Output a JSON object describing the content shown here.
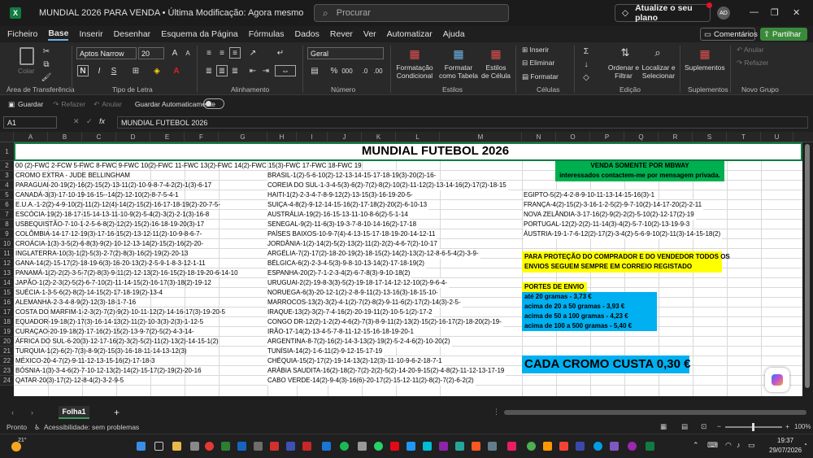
{
  "window": {
    "title": "MUNDIAL 2026 PARA VENDA • Última Modificação: Agora mesmo",
    "search_placeholder": "Procurar",
    "upgrade_label": "Atualize o seu plano",
    "avatar_initials": "AD"
  },
  "menu": [
    "Ficheiro",
    "Base",
    "Inserir",
    "Desenhar",
    "Esquema da Página",
    "Fórmulas",
    "Dados",
    "Rever",
    "Ver",
    "Automatizar",
    "Ajuda"
  ],
  "menu_active": "Base",
  "top_right": {
    "comments": "Comentários",
    "share": "Partilhar"
  },
  "ribbon": {
    "clipboard": {
      "paste": "Colar",
      "label": "Área de Transferência"
    },
    "font": {
      "name": "Aptos Narrow",
      "size": "20",
      "label": "Tipo de Letra",
      "bold": "N",
      "italic": "I",
      "underline": "S"
    },
    "alignment": {
      "label": "Alinhamento"
    },
    "number": {
      "format": "Geral",
      "label": "Número",
      "percent": "%",
      "thousands": "000"
    },
    "styles": {
      "conditional": "Formatação Condicional",
      "table": "Formatar como Tabela",
      "cell": "Estilos de Célula",
      "label": "Estilos"
    },
    "cells": {
      "insert": "Inserir",
      "delete": "Eliminar",
      "format": "Formatar",
      "label": "Células"
    },
    "editing": {
      "sort": "Ordenar e Filtrar",
      "find": "Localizar e Selecionar",
      "label": "Edição"
    },
    "addins": {
      "supplements": "Suplementos",
      "label": "Suplementos"
    },
    "undo_group": {
      "undo": "Anular",
      "redo": "Refazer",
      "label": "Novo Grupo"
    }
  },
  "quick_access": {
    "save": "Guardar",
    "redo": "Refazer",
    "undo": "Anular",
    "autosave": "Guardar Automaticamente"
  },
  "formula_bar": {
    "name_box": "A1",
    "fx": "fx",
    "content": "MUNDIAL FUTEBOL 2026"
  },
  "columns": [
    "A",
    "B",
    "C",
    "D",
    "E",
    "F",
    "G",
    "H",
    "I",
    "J",
    "K",
    "L",
    "M",
    "N",
    "O",
    "P",
    "Q",
    "R",
    "S",
    "T",
    "U"
  ],
  "rows": [
    "1",
    "2",
    "3",
    "4",
    "5",
    "6",
    "7",
    "8",
    "9",
    "10",
    "11",
    "12",
    "13",
    "14",
    "15",
    "16",
    "17",
    "18",
    "19",
    "20",
    "21",
    "22",
    "23",
    "24"
  ],
  "sheet": {
    "title": "MUNDIAL FUTEBOL 2026",
    "col_a": [
      "00 (2)-FWC 2-FCW 5-FWC 8-FWC 9-FWC 10(2)-FWC 11-FWC 13(2)-FWC 14(2)-FWC 15(3)-FWC 17-FWC 18-FWC 19",
      "CROMO EXTRA - JUDE BELLINGHAM",
      "PARAGUAI-20-19(2)-16(2)-15(2)-13-11(2)-10-9-8-7-4-2(2)-1(3)-6-17",
      "CANADÁ-3(3)-17-10-19-16-15--14(2)-12-10(2)-8-7-5-4-1",
      "E.U.A.-1-2(2)-4-9-10(2)-11(2)-12(4)-14(2)-15(2)-16-17-18-19(2)-20-7-5-",
      "ESCÓCIA-19(2)-18-17-15-14-13-11-10-9(2)-5-4(2)-3(2)-2-1(3)-16-8",
      "USBEQUISTÃO-7-10-1-2-5-6-8(2)-12(2)-15(2)-16-18-19-20(3)-17",
      "COLÔMBIA-14-17-12-19(3)-17-16-15(2)-13-12-11(2)-10-9-8-6-7-",
      "CROÁCIA-1(3)-3-5(2)-6-8(3)-9(2)-10-12-13-14(2)-15(2)-16(2)-20-",
      "INGLATERRA-10(3)-1(2)-5(3)-2-7(2)-8(3)-16(2)-19(2)-20-13",
      "GANA-14(2)-15-17(2)-18-19-6(3)-16-20-13(2)-2-5-9-1-8-3-12-1-11",
      "PANAMÁ-1(2)-2(2)-3-5-7(2)-8(3)-9-11(2)-12-13(2)-16-15(2)-18-19-20-6-14-10",
      "JAPÃO-1(2)-2-3(2)-5(2)-6-7-10(2)-11-14-15(2)-16-17(3)-18(2)-19-12",
      "SUÉCIA-1-3-5-6(2)-8(2)-14-15(2)-17-18-19(2)-13-4",
      "ALEMANHA-2-3-4-8-9(2)-12(3)-18-1-7-16",
      "COSTA DO MARFIM-1-2-3(2)-7(2)-9(2)-10-11-12(2)-14-16-17(3)-19-20-5",
      "EQUADOR-19-18(2)-17(3)-16-14-13(2)-11(2)-10-3(3)-2(3)-1-12-5",
      "CURAÇAO-20-19-18(2)-17-16(2)-15(2)-13-9-7(2)-5(2)-4-3-14-",
      "ÁFRICA DO SUL-6-20(3)-12-17-16(2)-3(2)-5(2)-11(2)-13(2)-14-15-1(2)",
      "TURQUIA-1(2)-6(2)-7(3)-8-9(2)-15(3)-16-18-11-14-13-12(3)",
      "MÉXICO-20-4-7(2)-9-11-12-13-15-16(2)-17-18-3",
      "BÓSNIA-1(3)-3-4-6(2)-7-10-12-13(2)-14(2)-15-17(2)-19(2)-20-16",
      "QATAR-20(3)-17(2)-12-8-4(2)-3-2-9-5"
    ],
    "col_h": [
      "BRASIL-1(2)-5-6-10(2)-12-13-14-15-17-18-19(3)-20(2)-16-",
      "COREIA DO SUL-1-3-4-5(3)-6(2)-7(2)-8(2)-10(2)-11-12(2)-13-14-16(2)-17(2)-18-15",
      "HAITI-1(2)-2-3-4-7-8-9-12(2)-13-15(3)-16-19-20-5-",
      "SUIÇA-4-8(2)-9-12-14-15-16(2)-17-18(2)-20(2)-6-10-13",
      "AUSTRÁLIA-19(2)-16-15-13-11-10-8-6(2)-5-1-14",
      "SENEGAL-9(2)-11-6(3)-19-3-7-8-10-14-16(2)-17-18",
      "PAÍSES BAIXOS-10-9-7(4)-4-13-15-17-18-19-20-14-12-11",
      "JORDÂNIA-1(2)-14(2)-5(2)-13(2)-11(2)-2(2)-4-6-7(2)-10-17",
      "ARGÉLIA-7(2)-17(2)-18-20-19(2)-18-15(2)-14(2)-13(2)-12-8-6-5-4(2)-3-9-",
      "BÉLGICA-6(2)-2-3-4-5(3)-9-8-10-13-14(2)-17-18-19(2)",
      "ESPANHA-20(2)-7-1-2-3-4(2)-6-7-8(3)-9-10-18(2)",
      "URUGUAI-2(2)-19-8-3(3)-5(2)-19-18-17-14-12-12-10(2)-9-6-4-",
      "NORUEGA-6(3)-20-12-1(2)-2-8-9-11(2)-13-16(3)-18-15-10-",
      "MARROCOS-13(2)-3(2)-4-1(2)-7(2)-8(2)-9-11-6(2)-17(2)-14(3)-2-5-",
      "IRAQUE-13(2)-3(2)-7-4-16(2)-20-19-11(2)-10-5-1(2)-17-2",
      "CONGO DR-12(2)-1-2(2)-4-6(2)-7(3)-8-9-11(2)-13(2)-15(2)-16-17(2)-18-20(2)-19-",
      "IRÃO-17-14(2)-13-4-5-7-8-11-12-15-16-18-19-20-1",
      "ARGENTINA-8-7(2)-16(2)-14-3-13(2)-19(2)-5-2-4-6(2)-10-20(2)",
      "TUNÍSIA-14(2)-1-6-11(2)-9-12-15-17-19",
      "CHÉQUIA-15(2)-17(2)-19-14-13(2)-12(3)-11-10-9-6-2-18-7-1",
      "ARÁBIA SAUDITA-16(2)-18(2)-7(2)-2(2)-5(2)-14-20-9-15(2)-4-8(2)-11-12-13-17-19",
      "CABO VERDE-14(2)-9-4(3)-16(6)-20-17(2)-15-12-11(2)-8(2)-7(2)-6-2(2)"
    ],
    "col_n": [
      "EGIPTO-5(2)-4-2-8-9-10-11-13-14-15-16(3)-1",
      "FRANÇA-4(2)-15(2)-3-16-1-2-5(2)-9-7-10(2)-14-17-20(2)-2-11",
      "NOVA ZELÂNDIA-3-17-16(2)-9(2)-2(2)-5-10(2)-12-17(2)-19",
      "PORTUGAL-12(2)-2(2)-11-14(3)-4(2)-5-7-10(2)-13-19-9-3",
      "ÁUSTRIA-19-1-7-6-12(2)-17(2)-3-4(2)-5-6-9-10(2)-11(3)-14-15-18(2)"
    ],
    "green_line1": "VENDA SOMENTE POR MBWAY",
    "green_line2": "interessados contactem-me por mensagem privada.",
    "protect_line1": "PARA PROTEÇÃO DO COMPRADOR E DO VENDEDOR TODOS OS",
    "protect_line2": "ENVIOS SEGUEM SEMPRE EM CORREIO REGISTADO",
    "shipping_title": "PORTES DE ENVIO",
    "shipping": [
      "até 20 gramas - 3,73 €",
      "acima de 20 a 50 gramas - 3,93 €",
      "acima de 50 a 100 gramas - 4,23 €",
      "acima de 100 a 500 gramas - 5,40 €"
    ],
    "price": "CADA CROMO CUSTA 0,30 €"
  },
  "sheet_tab": "Folha1",
  "status": {
    "ready": "Pronto",
    "accessibility": "Acessibilidade: sem problemas",
    "zoom": "100%"
  },
  "taskbar": {
    "weather": "21°",
    "time": "19:37",
    "date": "29/07/2026"
  },
  "colors": {
    "green": "#00b050",
    "yellow": "#ffff00",
    "blue": "#00b0f0",
    "excel": "#107c41"
  }
}
